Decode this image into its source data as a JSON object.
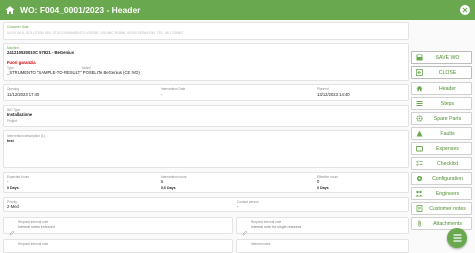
{
  "header": {
    "title": "WO: F004_0001/2023 - Header"
  },
  "form": {
    "customer": {
      "label": "Customer Data",
      "value": "ULIVI SA IL SOLUTION SRL STUCCHINAMENTO VERDE, VIA ABC ROMA, 00100 ROMA RM, TEL. 06 1234567"
    },
    "machine": {
      "label": "Machine",
      "value": "241210530010C 57821 - BeGenius",
      "warranty": "Fuori garanzia"
    },
    "type": {
      "label": "Type",
      "value": "_STRUMENTO \"SAMPLE-TO-RESULT\" POSELITe BeGenius (CE IVD)"
    },
    "model": {
      "label": "Model",
      "value": ""
    },
    "opening": {
      "label": "Opening",
      "value": "11/12/2023 17:40"
    },
    "intervention_date": {
      "label": "Intervention Date",
      "value": "-"
    },
    "planned": {
      "label": "Planned",
      "value": "13/12/2023 14:40"
    },
    "wo_type": {
      "label": "WO Type",
      "value": "Installazione"
    },
    "project": {
      "label": "Project",
      "value": ""
    },
    "intervention_description": {
      "label": "Intervention description (1)",
      "value": "test"
    },
    "expected_hours": {
      "label": "Expected hours",
      "value": "-",
      "sub": "0 Days"
    },
    "intervention_hours": {
      "label": "Intervention hours",
      "value": "5",
      "sub": "0,6 Days"
    },
    "effective_hours": {
      "label": "Effective hours",
      "value": "0",
      "sub": "0 Days"
    },
    "priority": {
      "label": "Priority",
      "value": "2-Med"
    },
    "contact_person": {
      "label": "Contact person",
      "value": "-"
    },
    "internal_notes": {
      "label": "Request internal note",
      "placeholder": "Internal notes enforced"
    },
    "single_notes": {
      "label": "Request internal note",
      "placeholder": "Internal note for single resource"
    },
    "extra_left": {
      "label": "Request internal note"
    },
    "extra_right": {
      "label": "Internal notes"
    }
  },
  "sidebar": {
    "save": "SAVE WO",
    "close": "CLOSE",
    "items": [
      {
        "label": "Header",
        "icon": "home-icon"
      },
      {
        "label": "Steps",
        "icon": "list-icon"
      },
      {
        "label": "Spare Parts",
        "icon": "gear-icon"
      },
      {
        "label": "Faults",
        "icon": "warning-icon"
      },
      {
        "label": "Expenses",
        "icon": "wallet-icon"
      },
      {
        "label": "Checklist",
        "icon": "checklist-icon"
      },
      {
        "label": "Configuration",
        "icon": "cog-icon"
      },
      {
        "label": "Engineers",
        "icon": "people-icon"
      },
      {
        "label": "Customer notes",
        "icon": "note-icon"
      },
      {
        "label": "Attachments",
        "icon": "paperclip-icon"
      }
    ]
  },
  "colors": {
    "accent": "#6aa84f",
    "accent_dark": "#4f8f34",
    "warning": "#cc0000"
  }
}
